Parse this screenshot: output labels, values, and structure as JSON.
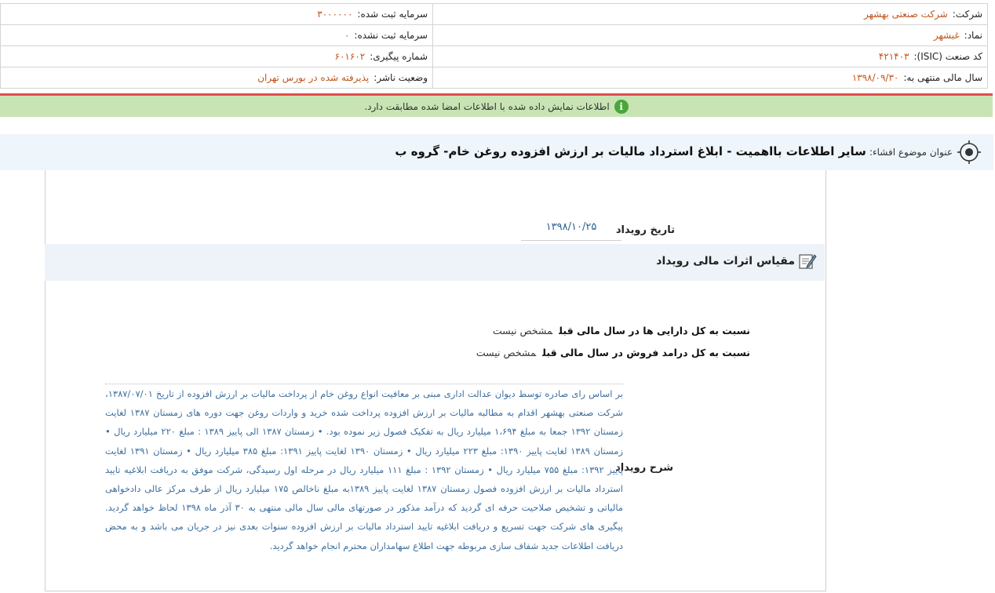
{
  "company_info": {
    "company_label": "شرکت:",
    "company_value": "شرکت صنعتی بهشهر",
    "symbol_label": "نماد:",
    "symbol_value": "غبشهر",
    "isic_label": "کد صنعت (ISIC):",
    "isic_value": "۴۲۱۴۰۳",
    "fiscal_year_label": "سال مالی منتهی به:",
    "fiscal_year_value": "۱۳۹۸/۰۹/۳۰",
    "registered_capital_label": "سرمایه ثبت شده:",
    "registered_capital_value": "۳۰۰۰۰۰۰",
    "unregistered_capital_label": "سرمایه ثبت نشده:",
    "unregistered_capital_value": "۰",
    "tracking_label": "شماره پیگیری:",
    "tracking_value": "۶۰۱۶۰۲",
    "publisher_status_label": "وضعیت ناشر:",
    "publisher_status_value": "پذیرفته شده در بورس تهران"
  },
  "banner": {
    "message": "اطلاعات نمایش داده شده با اطلاعات امضا شده مطابقت دارد.",
    "icon": "info-icon",
    "color": "#c8e4b4"
  },
  "subject": {
    "label": "عنوان موضوع افشاء:",
    "title": "سایر اطلاعات بااهمیت - ابلاغ استرداد مالیات بر ارزش افزوده روغن خام- گروه ب"
  },
  "event": {
    "date_label": "تاریخ رویداد",
    "date_value": "۱۳۹۸/۱۰/۲۵",
    "section_title": "مقیاس اثرات مالی رویداد",
    "ratio_assets_label": "نسبت به کل دارایی ها در سال مالی قبل",
    "ratio_assets_value": "مشخص نیست",
    "ratio_sales_label": "نسبت به کل درامد فروش در سال مالی قبل",
    "ratio_sales_value": "مشخص نیست",
    "description_label": "شرح رویداد",
    "description": "بر اساس رای صادره توسط دیوان عدالت اداری مبنی بر معافیت انواع روغن خام از پرداخت مالیات بر ارزش افزوده از تاریخ ۱۳۸۷/۰۷/۰۱، شرکت صنعتی بهشهر اقدام به مطالبه مالیات بر ارزش افزوده پرداخت شده خرید و واردات روغن جهت دوره های زمستان ۱۳۸۷ لغایت زمستان ۱۳۹۲ جمعا به مبلغ ۱،۶۹۴ میلیارد ریال به تفکیک فصول زیر نموده بود. • زمستان ۱۳۸۷ الی پاییز ۱۳۸۹ : مبلغ ۲۲۰ میلیارد ریال • زمستان ۱۳۸۹ لغایت پاییز ۱۳۹۰: مبلغ ۲۲۳ میلیارد ریال • زمستان ۱۳۹۰ لغایت پاییز ۱۳۹۱: مبلغ ۳۸۵ میلیارد ریال • زمستان ۱۳۹۱ لغایت پاییز ۱۳۹۲: مبلغ ۷۵۵ میلیارد ریال • زمستان ۱۳۹۲ : مبلغ ۱۱۱ میلیارد ریال در مرحله اول رسیدگی، شرکت موفق به دریافت ابلاغیه تایید استرداد مالیات بر ارزش افزوده فصول زمستان ۱۳۸۷ لغایت پاییز ۱۳۸۹به مبلغ ناخالص ۱۷۵ میلیارد ریال از طرف مرکز عالی دادخواهی مالیاتی و تشخیص صلاحیت حرفه ای گردید که درآمد مذکور در صورتهای مالی سال مالی منتهی به ۳۰ آذر ماه ۱۳۹۸ لحاظ خواهد گردید. پیگیری های شرکت جهت تسریع و دریافت ابلاغیه تایید استرداد مالیات بر ارزش افزوده سنوات بعدی نیز در جریان می باشد و به محض دریافت اطلاعات جدید شفاف سازی مربوطه جهت اطلاع سهامداران محترم انجام خواهد گردید."
  },
  "colors": {
    "accent_value": "#c0561f",
    "link_blue": "#3d6f9e",
    "banner_border": "#e24c4c"
  }
}
